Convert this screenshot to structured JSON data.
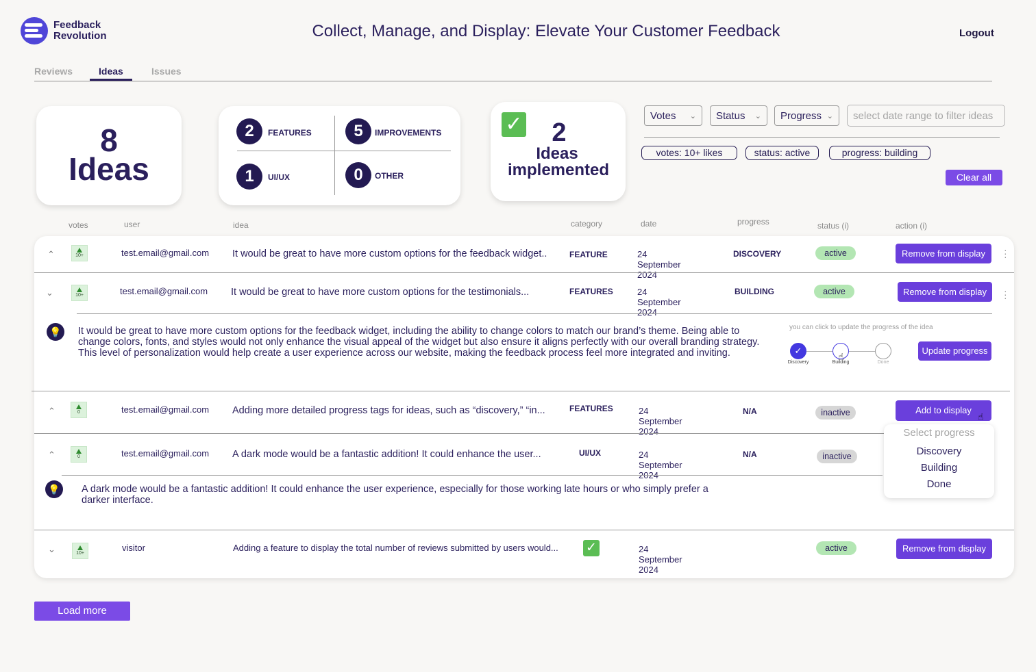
{
  "brand": {
    "line1": "Feedback",
    "line2": "Revolution"
  },
  "headline": "Collect, Manage, and Display: Elevate Your Customer Feedback",
  "logout_label": "Logout",
  "tabs": [
    {
      "label": "Reviews",
      "active": false
    },
    {
      "label": "Ideas",
      "active": true
    },
    {
      "label": "Issues",
      "active": false
    }
  ],
  "stats": {
    "ideas_count": "8",
    "ideas_label": "Ideas",
    "categories": [
      {
        "count": "2",
        "label": "FEATURES"
      },
      {
        "count": "5",
        "label": "IMPROVEMENTS"
      },
      {
        "count": "1",
        "label": "UI/UX"
      },
      {
        "count": "0",
        "label": "OTHER"
      }
    ],
    "implemented_count": "2",
    "implemented_line1": "Ideas",
    "implemented_line2": "implemented"
  },
  "filters": {
    "dropdowns": [
      "Votes",
      "Status",
      "Progress"
    ],
    "date_placeholder": "select date range to filter ideas",
    "chips": [
      "votes: 10+ likes",
      "status: active",
      "progress: building"
    ],
    "clear_label": "Clear all"
  },
  "table_headers": {
    "votes": "votes",
    "user": "user",
    "idea": "idea",
    "category": "category",
    "date": "date",
    "progress": "progress",
    "status": "status (i)",
    "action": "action (i)"
  },
  "rows": [
    {
      "votes": "10+",
      "user": "test.email@gmail.com",
      "idea": "It would be great to have more custom options for the feedback widget..",
      "category": "FEATURE",
      "date": "24 September 2024",
      "progress": "DISCOVERY",
      "status": "active",
      "action": "Remove from display"
    },
    {
      "votes": "10+",
      "user": "test.email@gmail.com",
      "idea": "It would be great to have more custom options for the testimonials...",
      "category": "FEATURES",
      "date": "24 September 2024",
      "progress": "BUILDING",
      "status": "active",
      "action": "Remove from display"
    },
    {
      "votes": "0",
      "user": "test.email@gmail.com",
      "idea": "Adding more detailed progress tags for ideas, such as “discovery,” “in...",
      "category": "FEATURES",
      "date": "24 September 2024",
      "progress": "N/A",
      "status": "inactive",
      "action": "Add to display"
    },
    {
      "votes": "0",
      "user": "test.email@gmail.com",
      "idea": "A dark mode would be a fantastic addition! It could enhance the user...",
      "category": "UI/UX",
      "date": "24 September 2024",
      "progress": "N/A",
      "status": "inactive",
      "action": ""
    },
    {
      "votes": "10+",
      "user": "visitor",
      "idea": "Adding a feature to display the total number of reviews submitted by users would...",
      "category": "",
      "date": "24 September 2024",
      "progress": "",
      "status": "active",
      "action": "Remove from display"
    }
  ],
  "expanded_1": {
    "text": "It would be great to have more custom options for the feedback widget, including the ability to change colors to match our brand’s theme. Being able to change colors, fonts, and styles would not only enhance the visual appeal of the widget but also ensure it aligns perfectly with our overall branding strategy. This level of personalization would help create a user experience across our website, making the feedback process feel more integrated and inviting.",
    "hint": "you can click to update the progress of the idea",
    "steps": [
      "Discovery",
      "Building",
      "Done"
    ],
    "update_label": "Update progress"
  },
  "expanded_2": {
    "text": "A dark mode would be a fantastic addition! It could enhance the user experience, especially for those working late hours or who simply prefer a darker interface."
  },
  "progress_menu": {
    "placeholder": "Select progress",
    "options": [
      "Discovery",
      "Building",
      "Done"
    ]
  },
  "load_more_label": "Load more",
  "colors": {
    "primary": "#6a3fdc",
    "navy": "#231a52",
    "active_badge": "#b3e6b3",
    "inactive_badge": "#d6d6d6",
    "vote_green": "#2e8b2e"
  }
}
